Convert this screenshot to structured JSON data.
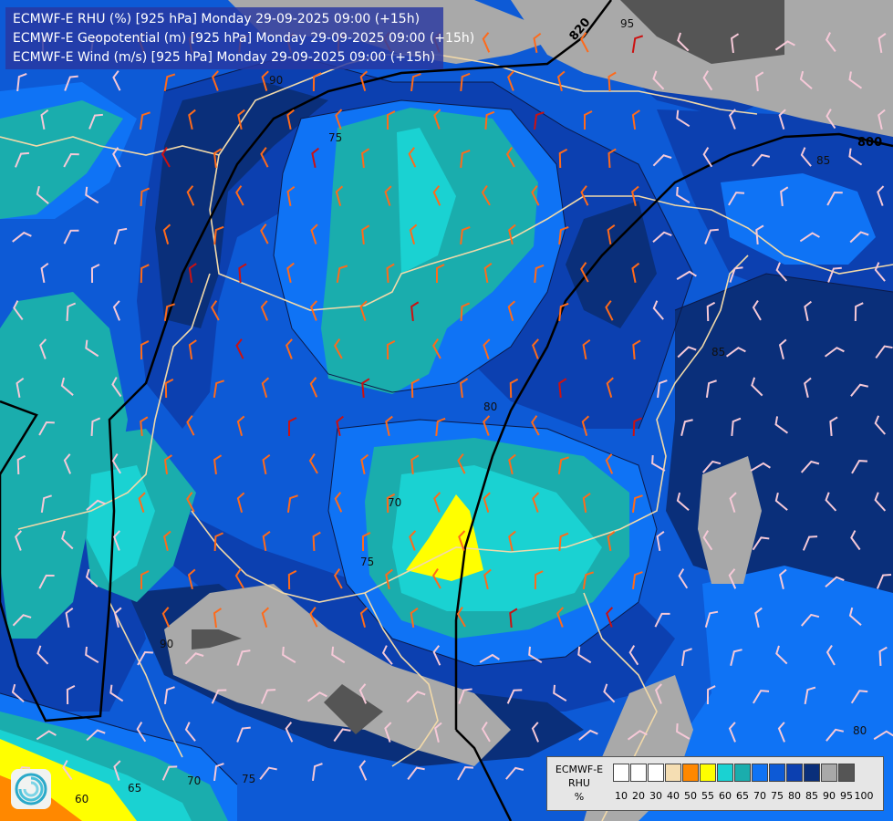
{
  "titles": [
    "ECMWF-E RHU (%) [925 hPa] Monday 29-09-2025 09:00 (+15h)",
    "ECMWF-E Geopotential (m) [925 hPa] Monday 29-09-2025 09:00 (+15h)",
    "ECMWF-E Wind (m/s) [925 hPa] Monday 29-09-2025 09:00 (+15h)"
  ],
  "legend": {
    "title_line1": "ECMWF-E",
    "title_line2": "RHU",
    "title_line3": "%",
    "ticks": [
      "10",
      "20",
      "30",
      "40",
      "50",
      "55",
      "60",
      "65",
      "70",
      "75",
      "80",
      "85",
      "90",
      "95",
      "100"
    ],
    "colors": [
      "#ffffff",
      "#ffffff",
      "#ffffff",
      "#ffffff",
      "#f5deb3",
      "#ff8800",
      "#ffff00",
      "#1ad2d2",
      "#1aadad",
      "#0f73f5",
      "#0d5ad6",
      "#0c40b0",
      "#0a2f7a",
      "#a9a9a9",
      "#555555"
    ]
  },
  "geopotential_labels": [
    "820",
    "800"
  ],
  "rhu_contour_labels": [
    "95",
    "90",
    "75",
    "85",
    "85",
    "80",
    "70",
    "75",
    "90",
    "65",
    "60",
    "70",
    "75",
    "80"
  ],
  "logo_name": "ecmwf-logo-icon"
}
